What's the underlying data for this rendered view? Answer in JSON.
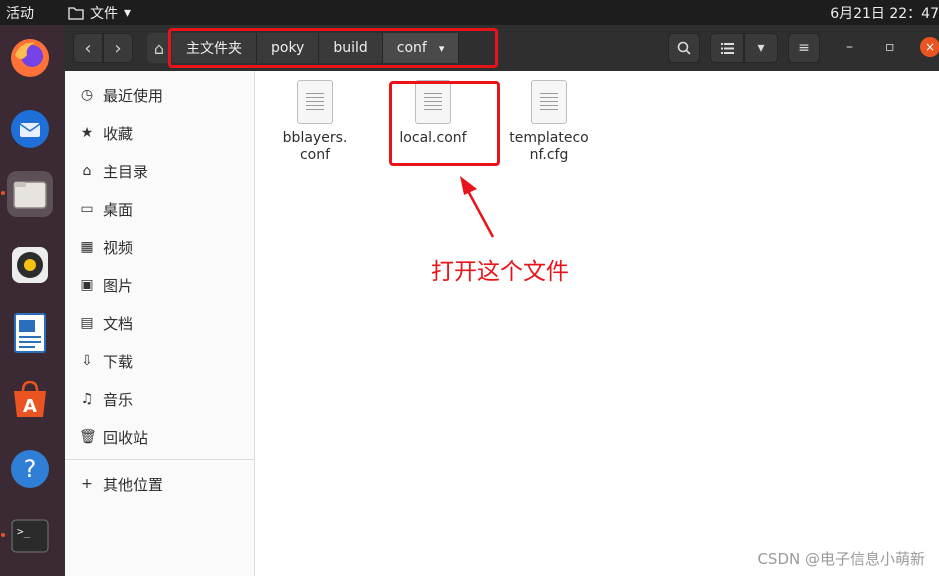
{
  "topbar": {
    "activities": "活动",
    "app_name": "文件",
    "app_dropdown": "▾",
    "clock": "6月21日 22：47"
  },
  "dock": {
    "items": [
      {
        "name": "firefox"
      },
      {
        "name": "thunderbird"
      },
      {
        "name": "files",
        "active": true
      },
      {
        "name": "rhythmbox"
      },
      {
        "name": "libreoffice-writer"
      },
      {
        "name": "ubuntu-software"
      },
      {
        "name": "help"
      },
      {
        "name": "terminal"
      }
    ]
  },
  "header": {
    "back_icon": "‹",
    "forward_icon": "›",
    "home_icon": "⌂",
    "breadcrumbs": [
      "主文件夹",
      "poky",
      "build",
      "conf"
    ],
    "dropdown_icon": "▾",
    "search_icon": "🔍",
    "list_view_icon": "☰",
    "menu_icon": "≡",
    "minimize": "–",
    "maximize": "▫",
    "close": "×"
  },
  "sidebar": {
    "items": [
      {
        "icon": "clock-icon",
        "glyph": "◷",
        "label": "最近使用"
      },
      {
        "icon": "star-icon",
        "glyph": "★",
        "label": "收藏"
      },
      {
        "icon": "home-icon",
        "glyph": "⌂",
        "label": "主目录"
      },
      {
        "icon": "desktop-icon",
        "glyph": "▭",
        "label": "桌面"
      },
      {
        "icon": "video-icon",
        "glyph": "▦",
        "label": "视频"
      },
      {
        "icon": "picture-icon",
        "glyph": "▣",
        "label": "图片"
      },
      {
        "icon": "document-icon",
        "glyph": "▤",
        "label": "文档"
      },
      {
        "icon": "download-icon",
        "glyph": "⇩",
        "label": "下载"
      },
      {
        "icon": "music-icon",
        "glyph": "♫",
        "label": "音乐"
      },
      {
        "icon": "trash-icon",
        "glyph": "🗑",
        "label": "回收站"
      },
      {
        "icon": "plus-icon",
        "glyph": "+",
        "label": "其他位置"
      }
    ]
  },
  "files": [
    {
      "name_line1": "bblayers.",
      "name_line2": "conf"
    },
    {
      "name_line1": "local.conf",
      "name_line2": ""
    },
    {
      "name_line1": "templateco",
      "name_line2": "nf.cfg"
    }
  ],
  "annotation": {
    "text": "打开这个文件",
    "color": "#e8141b"
  },
  "watermark": "CSDN @电子信息小萌新",
  "colors": {
    "accent": "#e95420",
    "highlight": "#e8141b",
    "headerbar": "#2f2f2f",
    "dock": "#3b2a34"
  }
}
